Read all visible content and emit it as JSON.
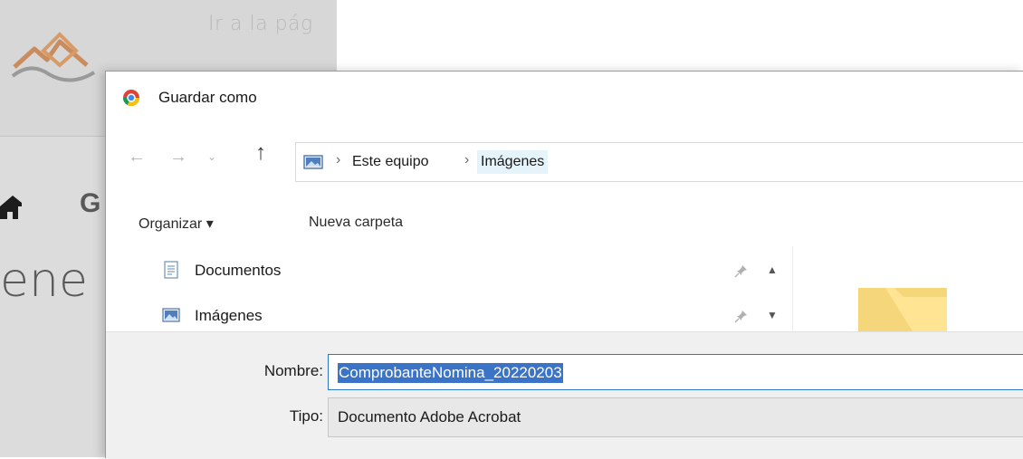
{
  "background_page": {
    "link_text": "Ir a la pág",
    "heading_fragment": "ene",
    "nav_letter": "G"
  },
  "dialog": {
    "title": "Guardar como",
    "nav": {
      "back": "←",
      "forward": "→",
      "dropdown": "⌄",
      "up": "↑"
    },
    "address": {
      "separator": "›",
      "crumbs": [
        "Este equipo",
        "Imágenes"
      ]
    },
    "toolbar": {
      "organize_label": "Organizar ▾",
      "new_folder_label": "Nueva carpeta"
    },
    "nav_pane": {
      "items": [
        {
          "label": "Documentos",
          "icon": "documents-icon"
        },
        {
          "label": "Imágenes",
          "icon": "pictures-icon"
        }
      ]
    },
    "filename": {
      "label": "Nombre:",
      "value": "ComprobanteNomina_20220203"
    },
    "filetype": {
      "label": "Tipo:",
      "value": "Documento Adobe Acrobat"
    }
  },
  "colors": {
    "selection": "#3b74c7",
    "breadcrumb_highlight": "#e5f3fb",
    "bottom_panel": "#f0f0f0"
  }
}
